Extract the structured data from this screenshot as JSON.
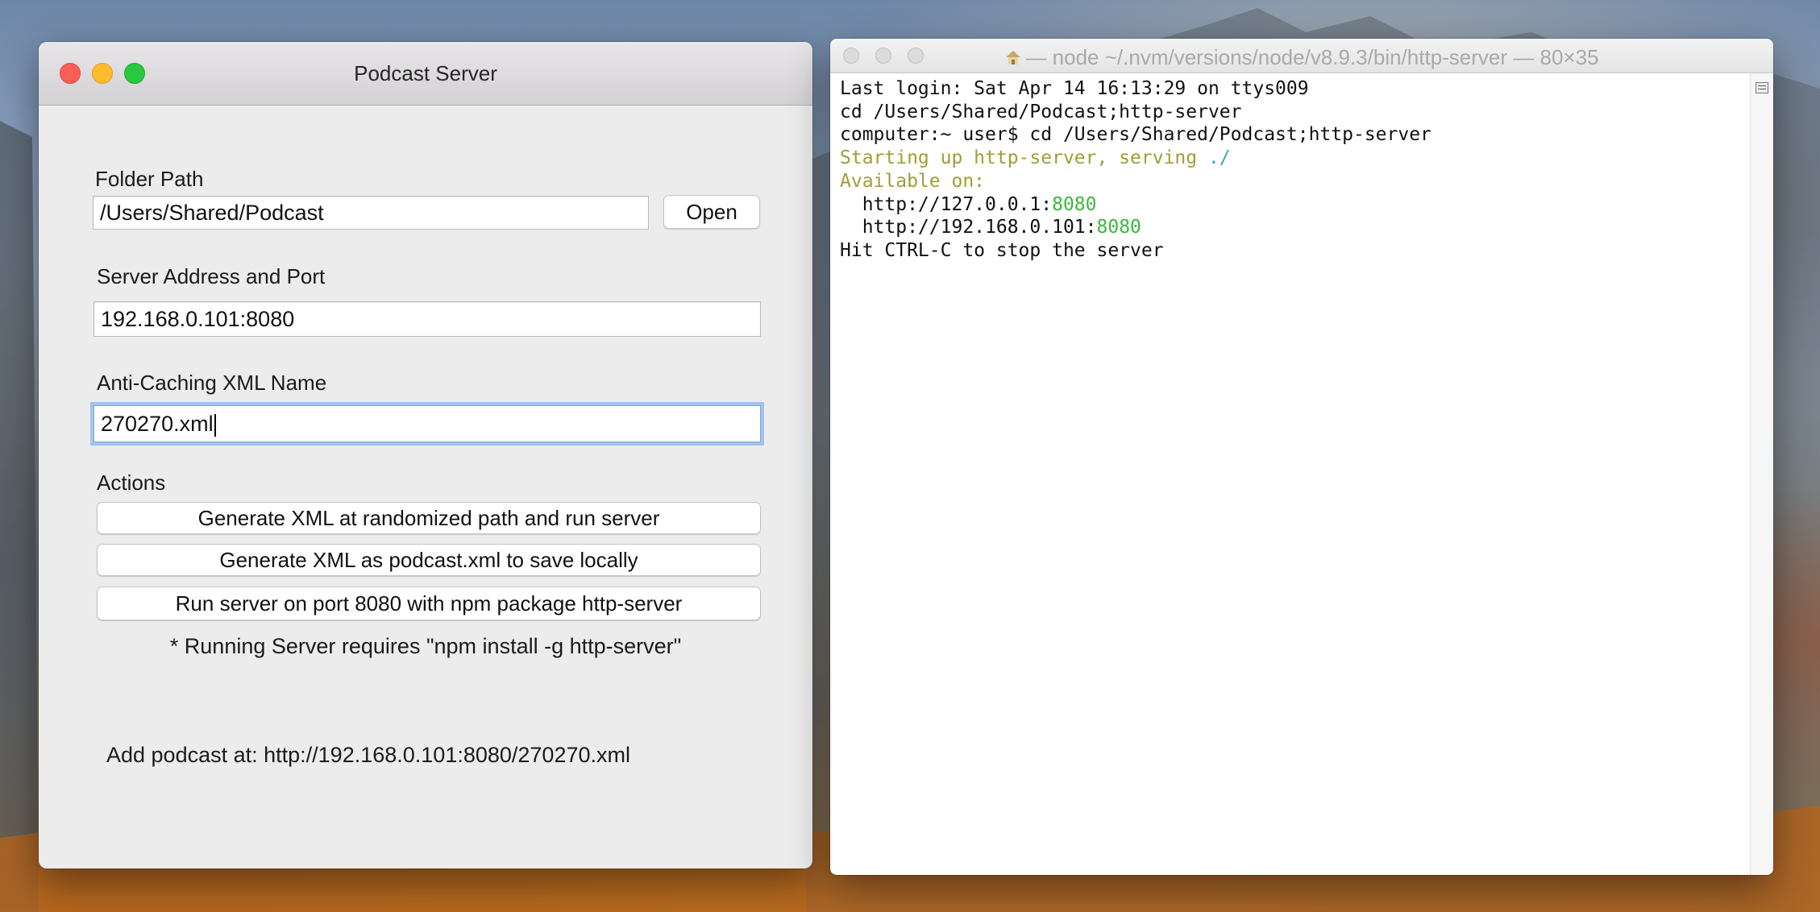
{
  "app_window": {
    "title": "Podcast Server",
    "folder_label": "Folder Path",
    "folder_value": "/Users/Shared/Podcast",
    "open_button": "Open",
    "server_label": "Server Address and Port",
    "server_value": "192.168.0.101:8080",
    "xml_label": "Anti-Caching XML Name",
    "xml_value": "270270.xml",
    "actions_label": "Actions",
    "actions": [
      "Generate XML at randomized path and run server",
      "Generate XML as podcast.xml to save locally",
      "Run server on port 8080 with npm package http-server"
    ],
    "note": "* Running Server requires \"npm install -g http-server\"",
    "podcast_url": "Add podcast at: http://192.168.0.101:8080/270270.xml"
  },
  "terminal": {
    "title": "— node ~/.nvm/versions/node/v8.9.3/bin/http-server — 80×35",
    "lines": {
      "l1": "Last login: Sat Apr 14 16:13:29 on ttys009",
      "l2": "cd /Users/Shared/Podcast;http-server",
      "l3": "computer:~ user$ cd /Users/Shared/Podcast;http-server",
      "l4a": "Starting up http-server, serving ",
      "l4b": "./",
      "l5": "Available on:",
      "l6a": "  http://127.0.0.1:",
      "l6b": "8080",
      "l7a": "  http://192.168.0.101:",
      "l7b": "8080",
      "l8": "Hit CTRL-C to stop the server"
    }
  },
  "colors": {
    "close": "#fc5f57",
    "minimize": "#fdbc2e",
    "maximize": "#28c840",
    "focus_ring": "#a3c2ee",
    "term_olive": "#9f9f34",
    "term_cyan": "#3aa3c4",
    "term_green": "#3db73d"
  }
}
